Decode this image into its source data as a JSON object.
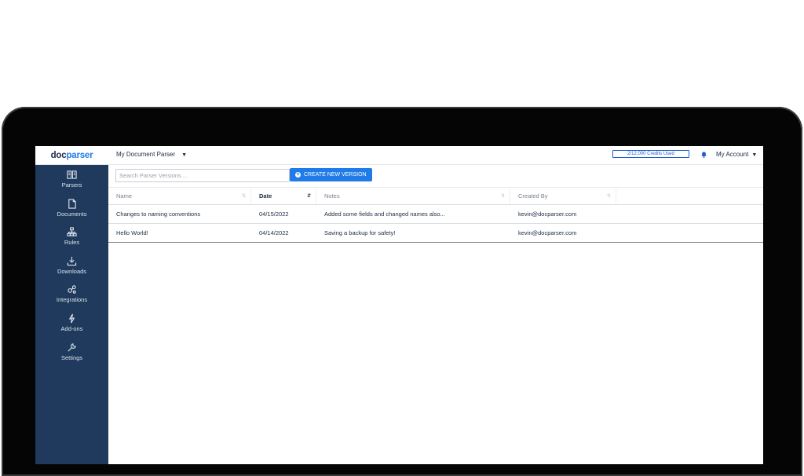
{
  "brand": {
    "logo_prefix": "doc",
    "logo_suffix": "parser"
  },
  "topbar": {
    "parser_name": "My Document Parser",
    "credits": "2/12,000 Credits Used",
    "account": "My Account"
  },
  "sidebar": {
    "items": [
      {
        "label": "Parsers",
        "icon": "parsers-icon"
      },
      {
        "label": "Documents",
        "icon": "document-icon"
      },
      {
        "label": "Rules",
        "icon": "rules-icon"
      },
      {
        "label": "Downloads",
        "icon": "download-icon"
      },
      {
        "label": "Integrations",
        "icon": "integrations-icon"
      },
      {
        "label": "Add-ons",
        "icon": "addons-icon"
      },
      {
        "label": "Settings",
        "icon": "wrench-icon"
      }
    ]
  },
  "toolbar": {
    "search_placeholder": "Search Parser Versions ...",
    "create_label": "CREATE NEW VERSION"
  },
  "table": {
    "columns": [
      "Name",
      "Date",
      "Notes",
      "Created By"
    ],
    "rows": [
      {
        "name": "Changes to naming conventions",
        "date": "04/15/2022",
        "notes": "Added some fields and changed names also...",
        "created_by": "kevin@docparser.com"
      },
      {
        "name": "Hello World!",
        "date": "04/14/2022",
        "notes": "Saving a backup for safety!",
        "created_by": "kevin@docparser.com"
      }
    ]
  },
  "colors": {
    "sidebar": "#1f3a5c",
    "accent": "#1e7be8",
    "bezel": "#050505"
  }
}
